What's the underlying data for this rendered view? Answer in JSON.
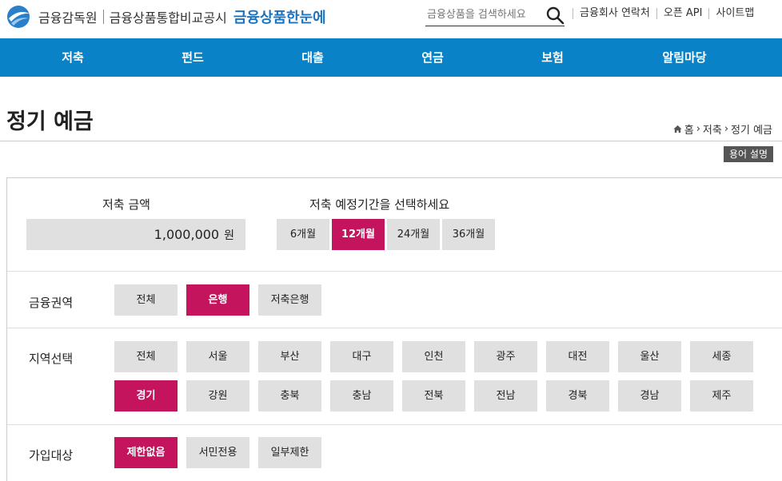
{
  "header": {
    "org_name": "금융감독원",
    "service_name": "금융상품통합비교공시",
    "brand": "금융상품한눈에",
    "search_placeholder": "금융상품을 검색하세요",
    "links": [
      "금융회사 연락처",
      "오픈 API",
      "사이트맵"
    ]
  },
  "nav": {
    "items": [
      "저축",
      "펀드",
      "대출",
      "연금",
      "보험",
      "알림마당"
    ]
  },
  "page": {
    "title": "정기 예금",
    "breadcrumb": [
      "홈",
      "저축",
      "정기 예금"
    ],
    "glossary_button": "용어 설명"
  },
  "amount": {
    "label": "저축 금액",
    "value": "1,000,000",
    "unit": "원"
  },
  "period": {
    "label": "저축 예정기간을 선택하세요",
    "options": [
      "6개월",
      "12개월",
      "24개월",
      "36개월"
    ],
    "selected": "12개월"
  },
  "filters": {
    "sector": {
      "label": "금융권역",
      "options": [
        "전체",
        "은행",
        "저축은행"
      ],
      "selected": "은행"
    },
    "region": {
      "label": "지역선택",
      "options": [
        "전체",
        "서울",
        "부산",
        "대구",
        "인천",
        "광주",
        "대전",
        "울산",
        "세종",
        "경기",
        "강원",
        "충북",
        "충남",
        "전북",
        "전남",
        "경북",
        "경남",
        "제주"
      ],
      "selected": "경기"
    },
    "eligibility": {
      "label": "가입대상",
      "options": [
        "제한없음",
        "서민전용",
        "일부제한"
      ],
      "selected": "제한없음"
    }
  },
  "colors": {
    "nav": "#0a82c8",
    "accent": "#c3145d",
    "button": "#e0e0e0"
  },
  "icons": {
    "search": "search-icon",
    "home": "home-icon",
    "logo": "fss-logo-icon"
  }
}
